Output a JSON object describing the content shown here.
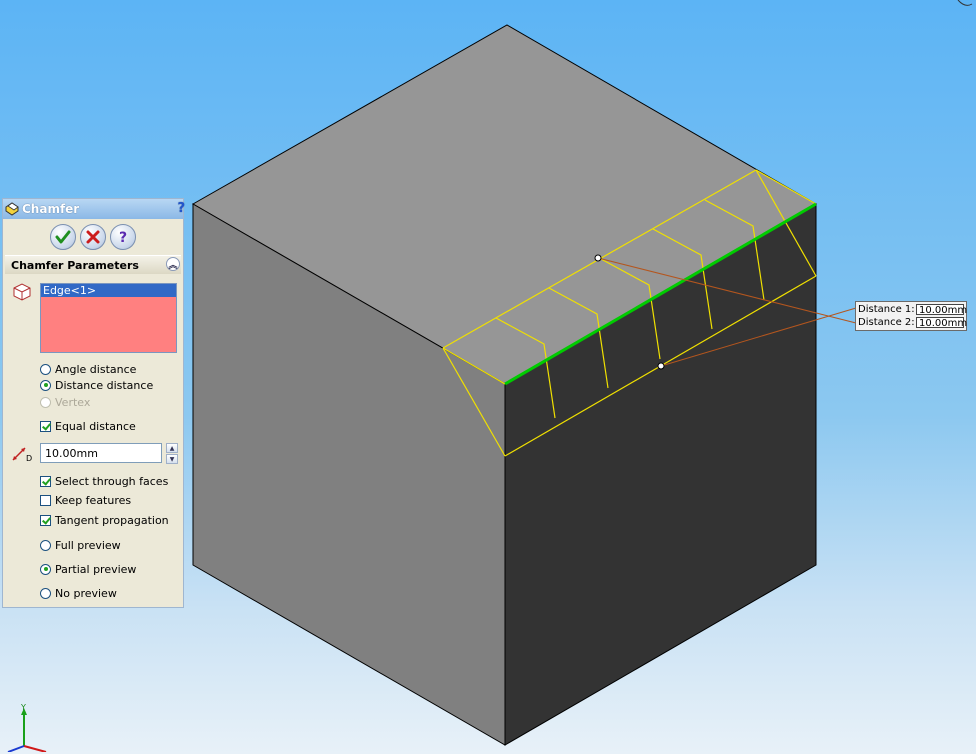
{
  "panel": {
    "title": "Chamfer",
    "help_glyph": "?",
    "group_title": "Chamfer Parameters",
    "selection_items": [
      "Edge<1>"
    ],
    "options": {
      "angle_distance": "Angle distance",
      "distance_distance": "Distance distance",
      "vertex": "Vertex",
      "equal_distance": "Equal distance",
      "select_through_faces": "Select through faces",
      "keep_features": "Keep features",
      "tangent_propagation": "Tangent propagation",
      "full_preview": "Full preview",
      "partial_preview": "Partial preview",
      "no_preview": "No preview"
    },
    "distance_value": "10.00mm",
    "distance_icon_label": "D"
  },
  "callout": {
    "distance1_label": "Distance 1:",
    "distance1_value": "10.00mm",
    "distance2_label": "Distance 2:",
    "distance2_value": "10.00mm"
  },
  "triad": {
    "y_label": "Y"
  },
  "colors": {
    "selection_bg": "#ff8080",
    "selected_item": "#3169c6",
    "preview_lines": "#f0e000",
    "selected_edge": "#00cc00",
    "cube_top": "#969696",
    "cube_left": "#808080",
    "cube_right": "#333333"
  }
}
